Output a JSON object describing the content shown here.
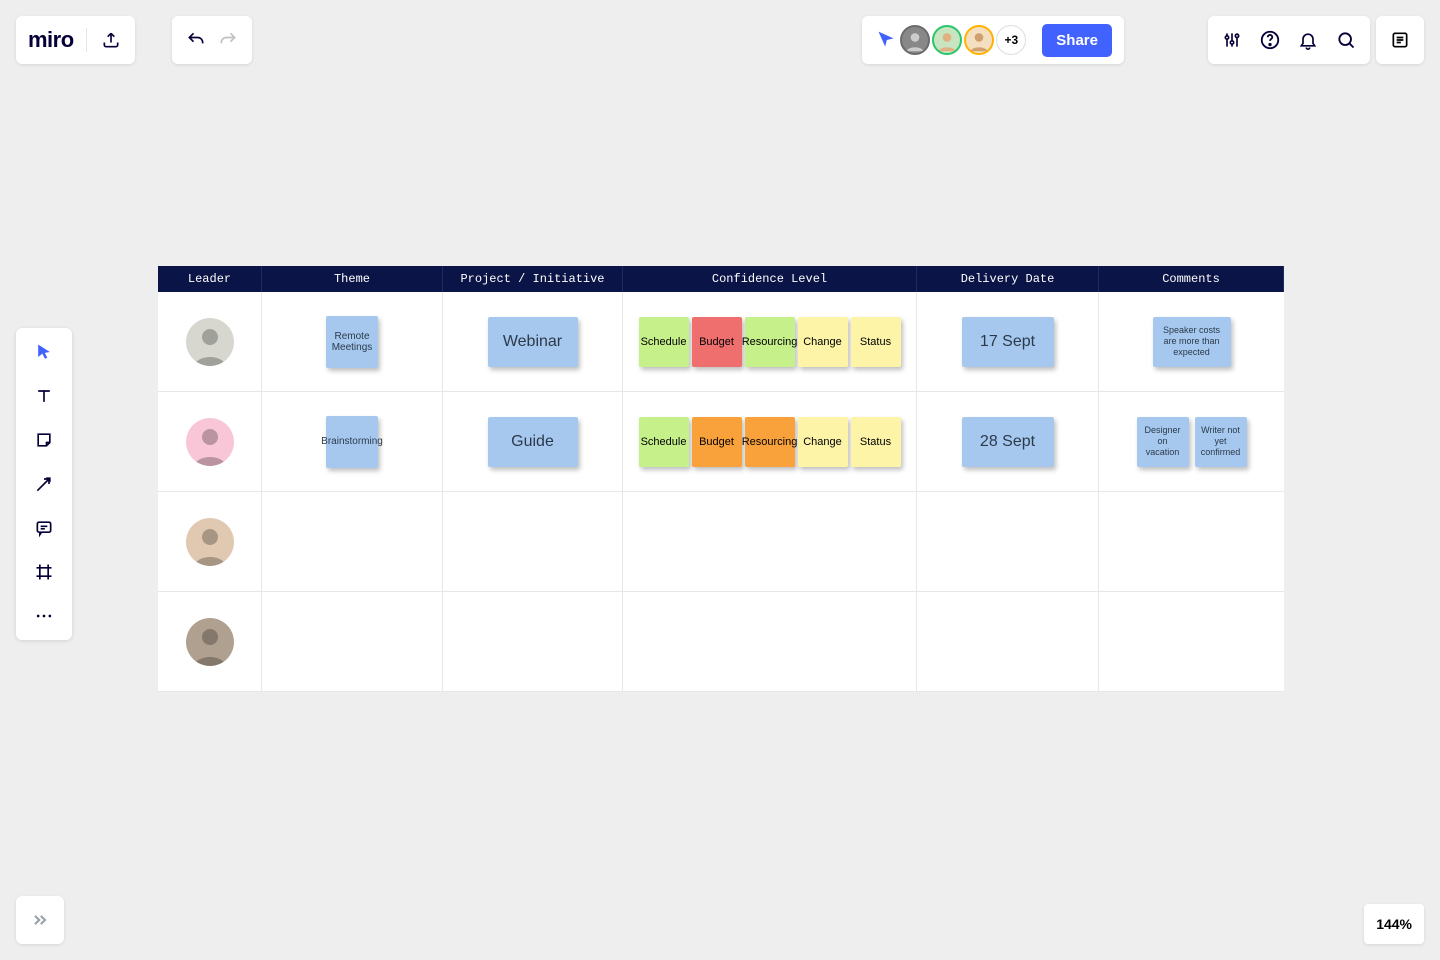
{
  "logo": "miro",
  "collab": {
    "moreCount": "+3",
    "share": "Share"
  },
  "zoom": "144%",
  "headers": {
    "leader": "Leader",
    "theme": "Theme",
    "project": "Project / Initiative",
    "confidence": "Confidence Level",
    "delivery": "Delivery Date",
    "comments": "Comments"
  },
  "confLabels": [
    "Schedule",
    "Budget",
    "Resourcing",
    "Change",
    "Status"
  ],
  "rows": [
    {
      "theme": "Remote Meetings",
      "project": "Webinar",
      "confColors": [
        "n-green",
        "n-red",
        "n-green",
        "n-yellow",
        "n-yellow"
      ],
      "delivery": "17 Sept",
      "comments": [
        "Speaker costs are more than expected"
      ]
    },
    {
      "theme": "Brainstorming",
      "project": "Guide",
      "confColors": [
        "n-green",
        "n-orange",
        "n-orange",
        "n-yellow",
        "n-yellow"
      ],
      "delivery": "28 Sept",
      "comments": [
        "Designer on vacation",
        "Writer not yet confirmed"
      ]
    },
    {
      "theme": "",
      "project": "",
      "confColors": [],
      "delivery": "",
      "comments": []
    },
    {
      "theme": "",
      "project": "",
      "confColors": [],
      "delivery": "",
      "comments": []
    }
  ],
  "avatarRings": [
    "#6b6b6b",
    "#2ac66b",
    "#ffb300"
  ],
  "leaderBg": [
    "#d7d7cf",
    "#f8c6d6",
    "#e0c9b0",
    "#b0a090"
  ]
}
